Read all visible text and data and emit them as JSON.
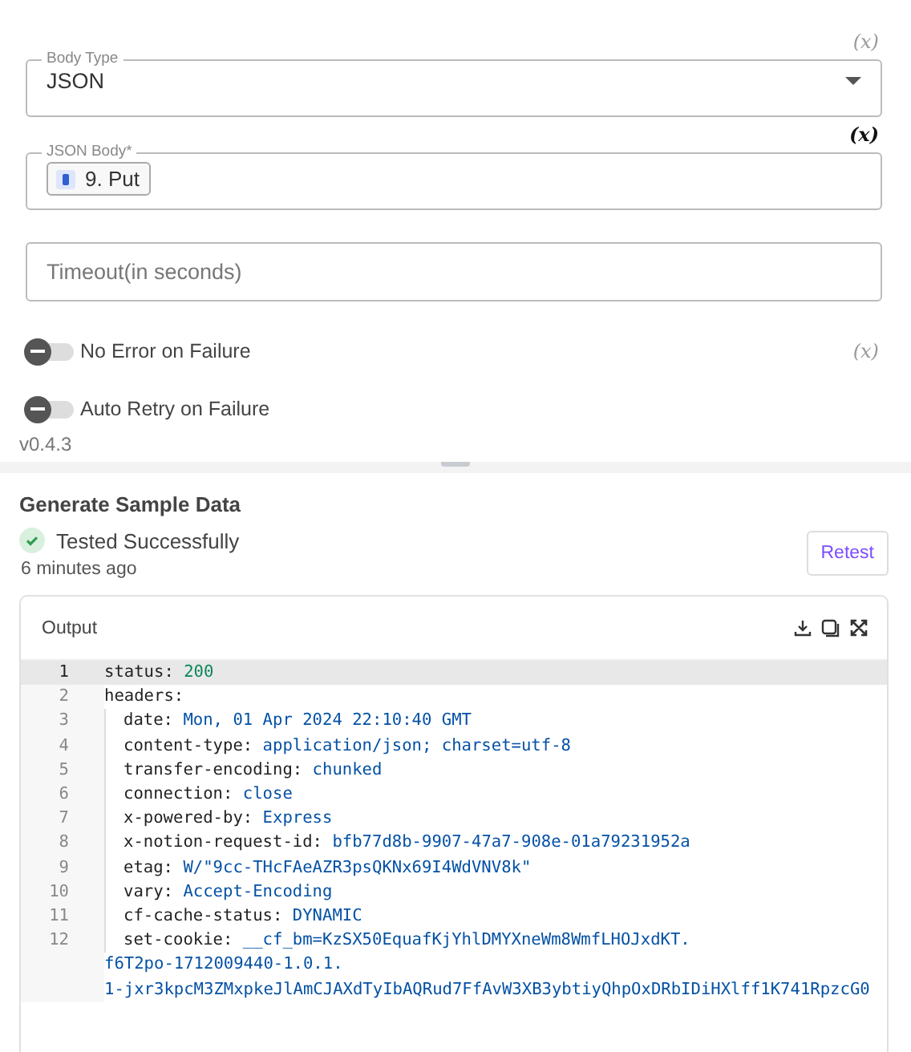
{
  "form": {
    "fields": [
      {
        "kind": "select",
        "label": "Body Type",
        "value": "JSON",
        "variable_mark": "(x)",
        "variable_active": false
      },
      {
        "kind": "chip",
        "label": "JSON Body*",
        "chip": "9. Put",
        "variable_mark": "(x)",
        "variable_active": true
      },
      {
        "kind": "input",
        "placeholder": "Timeout(in seconds)"
      },
      {
        "kind": "toggle",
        "label": "No Error on Failure",
        "on": false,
        "variable_mark": "(x)",
        "variable_active": false
      },
      {
        "kind": "toggle",
        "label": "Auto Retry on Failure",
        "on": false
      }
    ]
  },
  "version": "v0.4.3",
  "sample": {
    "title": "Generate Sample Data",
    "status": "Tested Successfully",
    "time": "6 minutes ago",
    "retest": "Retest",
    "output": {
      "title": "Output",
      "lines": [
        {
          "num": "1",
          "key": "status:",
          "value": "200",
          "kind": "number",
          "current": true
        },
        {
          "num": "2",
          "key": "headers:",
          "current": false,
          "children": [
            {
              "num": "3",
              "key": "date:",
              "value": "Mon, 01 Apr 2024 22:10:40 GMT",
              "kind": "string",
              "current": false
            },
            {
              "num": "4",
              "key": "content-type:",
              "value": "application/json; charset=utf-8",
              "kind": "string",
              "current": false
            },
            {
              "num": "5",
              "key": "transfer-encoding:",
              "value": "chunked",
              "kind": "string",
              "current": false
            },
            {
              "num": "6",
              "key": "connection:",
              "value": "close",
              "kind": "string",
              "current": false
            },
            {
              "num": "7",
              "key": "x-powered-by:",
              "value": "Express",
              "kind": "string",
              "current": false
            },
            {
              "num": "8",
              "key": "x-notion-request-id:",
              "value": "bfb77d8b-9907-47a7-908e-01a79231952a",
              "kind": "string",
              "current": false
            },
            {
              "num": "9",
              "key": "etag:",
              "value": "W/\"9cc-THcFAeAZR3psQKNx69I4WdVNV8k\"",
              "kind": "string",
              "current": false
            },
            {
              "num": "10",
              "key": "vary:",
              "value": "Accept-Encoding",
              "kind": "string",
              "current": false
            },
            {
              "num": "11",
              "key": "cf-cache-status:",
              "value": "DYNAMIC",
              "kind": "string",
              "current": false
            },
            {
              "num": "12",
              "key": "set-cookie:",
              "value": "__cf_bm=KzSX50EquafKjYhlDMYXneWm8WmfLHOJxdKT.",
              "wrapped": [
                "f6T2po-1712009440-1.0.1.",
                "1-jxr3kpcM3ZMxpkeJlAmCJAXdTyIbAQRud7FfAvW3XB3ybtiyQhpOxDRbIDiHXlff1K741RpzcG0"
              ],
              "kind": "string",
              "current": false
            }
          ]
        }
      ]
    }
  }
}
